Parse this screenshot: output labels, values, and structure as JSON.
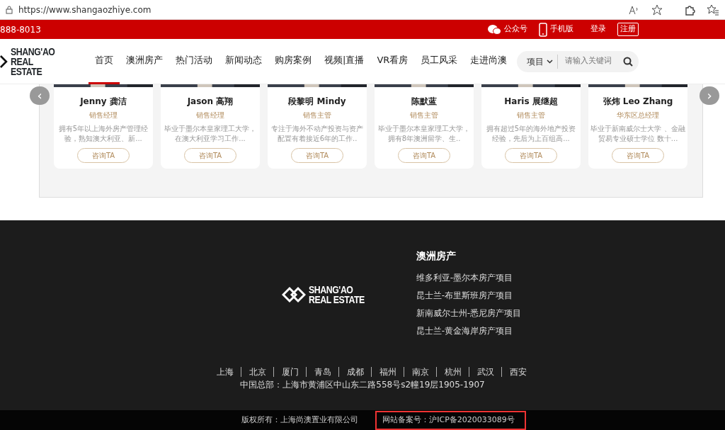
{
  "browser": {
    "url": "https://www.shangaozhiye.com"
  },
  "topbar": {
    "phone": "888-8013",
    "links": [
      {
        "kind": "wechat",
        "label": "公众号"
      },
      {
        "kind": "mobile",
        "label": "手机版"
      },
      {
        "kind": "plain",
        "label": "登录"
      },
      {
        "kind": "boxed",
        "label": "注册"
      }
    ]
  },
  "header": {
    "logo": [
      "SHANG'AO",
      "REAL ESTATE"
    ],
    "nav": [
      {
        "label": "首页",
        "selected": true
      },
      {
        "label": "澳洲房产",
        "selected": false
      },
      {
        "label": "热门活动",
        "selected": false
      },
      {
        "label": "新闻动态",
        "selected": false
      },
      {
        "label": "购房案例",
        "selected": false
      },
      {
        "label": "视频|直播",
        "selected": false
      },
      {
        "label": "VR看房",
        "selected": false
      },
      {
        "label": "员工风采",
        "selected": false
      },
      {
        "label": "走进尚澳",
        "selected": false
      }
    ],
    "search": {
      "scope": "项目",
      "placeholder": "请输入关键词"
    }
  },
  "carousel": {
    "prev": "‹",
    "next": "›",
    "cards": [
      {
        "name": "Jenny 龚洁",
        "title": "销售经理",
        "bio": "拥有5年以上海外房产管理经验，熟知澳大利亚、新...",
        "button": "咨询TA"
      },
      {
        "name": "Jason 高翔",
        "title": "销售经理",
        "bio": "毕业于墨尔本皇家理工大学，在澳大利亚学习工作...",
        "button": "咨询TA"
      },
      {
        "name": "段黎明 Mindy",
        "title": "销售主管",
        "bio": "专注于海外不动产投资与资产配置有着接近6年的工作..",
        "button": "咨询TA"
      },
      {
        "name": "陈默蓝",
        "title": "销售主管",
        "bio": "毕业于墨尔本皇家理工大学，拥有8年澳洲留学、生..",
        "button": "咨询TA"
      },
      {
        "name": "Haris 展继超",
        "title": "销售主管",
        "bio": "拥有超过5年的海外地产投资经验，先后为上百组高...",
        "button": "咨询TA"
      },
      {
        "name": "张炜 Leo Zhang",
        "title": "华东区总经理",
        "bio": "毕业于新南威尔士大学 、金融贸易专业硕士学位 数十...",
        "button": "咨询TA"
      }
    ]
  },
  "footer": {
    "logo": [
      "SHANG'AO",
      "REAL ESTATE"
    ],
    "heading": "澳洲房产",
    "links": [
      "维多利亚-墨尔本房产项目",
      "昆士兰-布里斯班房产项目",
      "新南威尔士州-悉尼房产项目",
      "昆士兰-黄金海岸房产项目"
    ],
    "cities": [
      "上海",
      "北京",
      "厦门",
      "青岛",
      "成都",
      "福州",
      "南京",
      "杭州",
      "武汉",
      "西安"
    ],
    "address": "中国总部：上海市黄浦区中山东二路558号s2幢19层1905-1907",
    "copyright": "版权所有：上海尚澳置业有限公司",
    "icp": "网站备案号：沪ICP备2020033089号"
  }
}
